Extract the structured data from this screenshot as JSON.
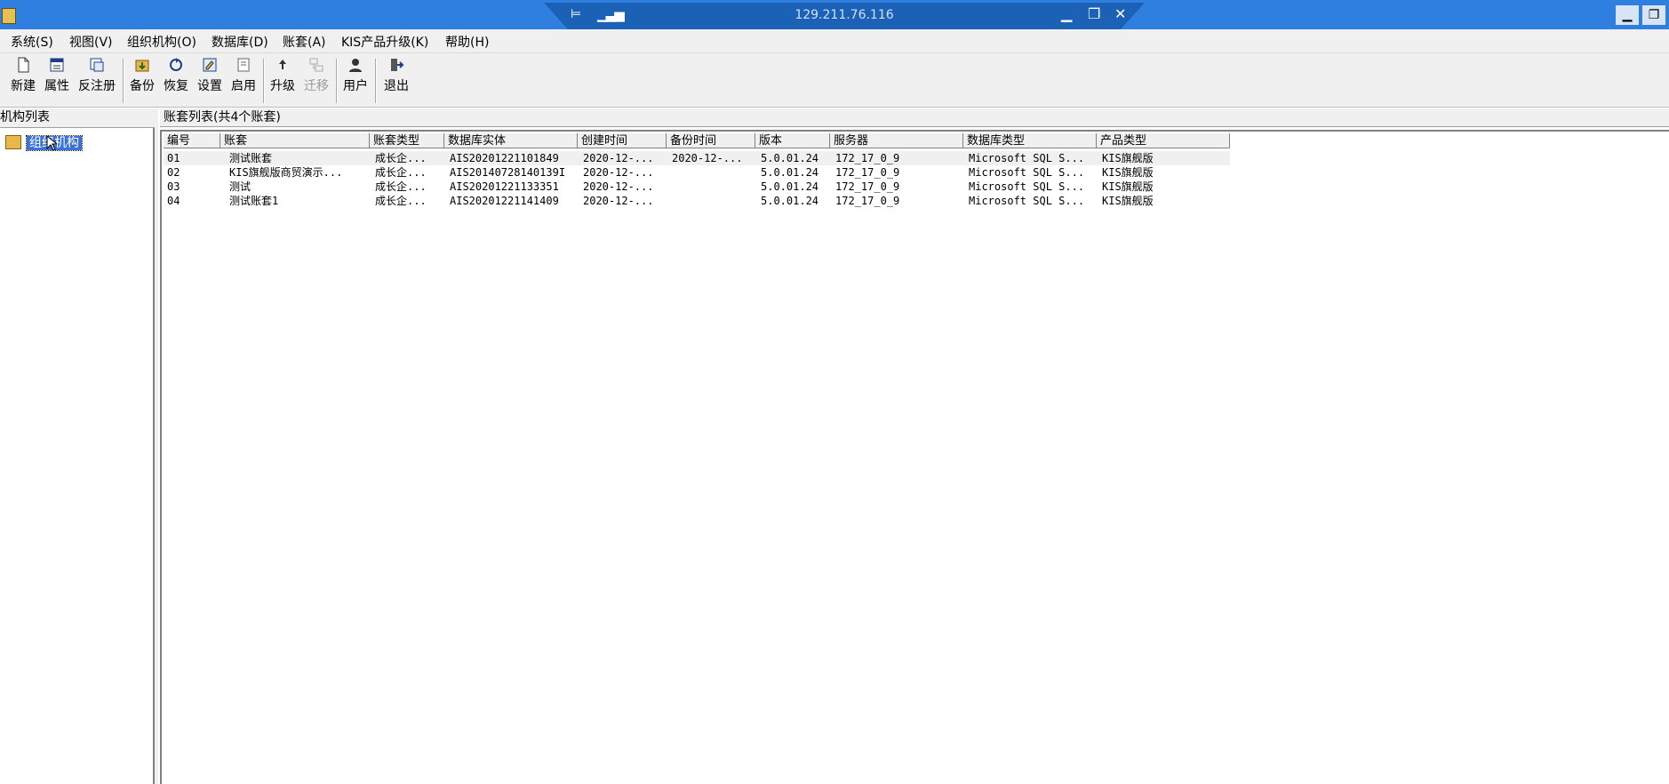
{
  "titlebar": {
    "remote_ip": "129.211.76.116",
    "pin_glyph": "⊨",
    "signal_glyph": "▁▃▅",
    "minimize_glyph": "▁",
    "restore_glyph": "❐",
    "close_glyph": "✕"
  },
  "menu": {
    "system": "系统(S)",
    "view": "视图(V)",
    "org": "组织机构(O)",
    "database": "数据库(D)",
    "account": "账套(A)",
    "upgrade": "KIS产品升级(K)",
    "help": "帮助(H)"
  },
  "toolbar": {
    "new": "新建",
    "properties": "属性",
    "unregister": "反注册",
    "backup": "备份",
    "restore": "恢复",
    "settings": "设置",
    "enable": "启用",
    "upgrade": "升级",
    "migrate": "迁移",
    "user": "用户",
    "exit": "退出"
  },
  "left_panel": {
    "header": "机构列表",
    "root_node": "组织机构"
  },
  "right_panel": {
    "header": "账套列表(共4个账套)",
    "columns": [
      "编号",
      "账套",
      "账套类型",
      "数据库实体",
      "创建时间",
      "备份时间",
      "版本",
      "服务器",
      "数据库类型",
      "产品类型"
    ],
    "rows": [
      [
        "01",
        "测试账套",
        "成长企...",
        "AIS20201221101849",
        "2020-12-...",
        "2020-12-...",
        "5.0.01.24",
        "172_17_0_9",
        "Microsoft SQL S...",
        "KIS旗舰版"
      ],
      [
        "02",
        "KIS旗舰版商贸演示...",
        "成长企...",
        "AIS20140728140139I",
        "2020-12-...",
        "",
        "5.0.01.24",
        "172_17_0_9",
        "Microsoft SQL S...",
        "KIS旗舰版"
      ],
      [
        "03",
        "测试",
        "成长企...",
        "AIS20201221133351",
        "2020-12-...",
        "",
        "5.0.01.24",
        "172_17_0_9",
        "Microsoft SQL S...",
        "KIS旗舰版"
      ],
      [
        "04",
        "测试账套1",
        "成长企...",
        "AIS20201221141409",
        "2020-12-...",
        "",
        "5.0.01.24",
        "172_17_0_9",
        "Microsoft SQL S...",
        "KIS旗舰版"
      ]
    ]
  },
  "colors": {
    "titlebar": "#2f7fe0",
    "rdp_bar": "#1b61b5",
    "selection": "#3b72d8",
    "chrome": "#f0f0f0"
  },
  "icons": {
    "app": "app-icon",
    "folder": "folder-icon",
    "cursor": "mouse-cursor-icon"
  }
}
